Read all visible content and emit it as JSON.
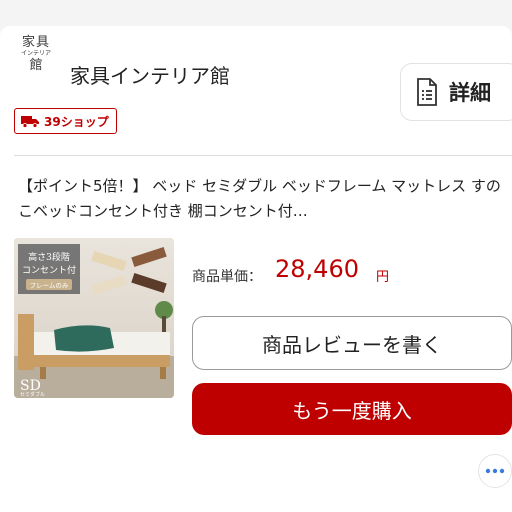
{
  "shop": {
    "logo": {
      "line1": "家具",
      "line2": "インテリア",
      "line3": "館"
    },
    "name": "家具インテリア館",
    "detail_label": "詳細",
    "badge_label": "39ショップ"
  },
  "product": {
    "title": "【ポイント5倍！】 ベッド セミダブル ベッドフレーム マットレス すのこベッドコンセント付き 棚コンセント付…",
    "image_text": {
      "heading": "高さ3段階",
      "heading2": "コンセント付",
      "sub": "フレームのみ",
      "size": "SD",
      "size_sub": "セミダブル"
    },
    "price_label": "商品単価：",
    "price": "28,460",
    "price_unit": "円",
    "review_button": "商品レビューを書く",
    "rebuy_button": "もう一度購入"
  },
  "colors": {
    "accent": "#bf0000",
    "icon_blue": "#3b7ddd"
  },
  "icons": [
    "doc-icon",
    "truck-icon",
    "more-icon"
  ]
}
